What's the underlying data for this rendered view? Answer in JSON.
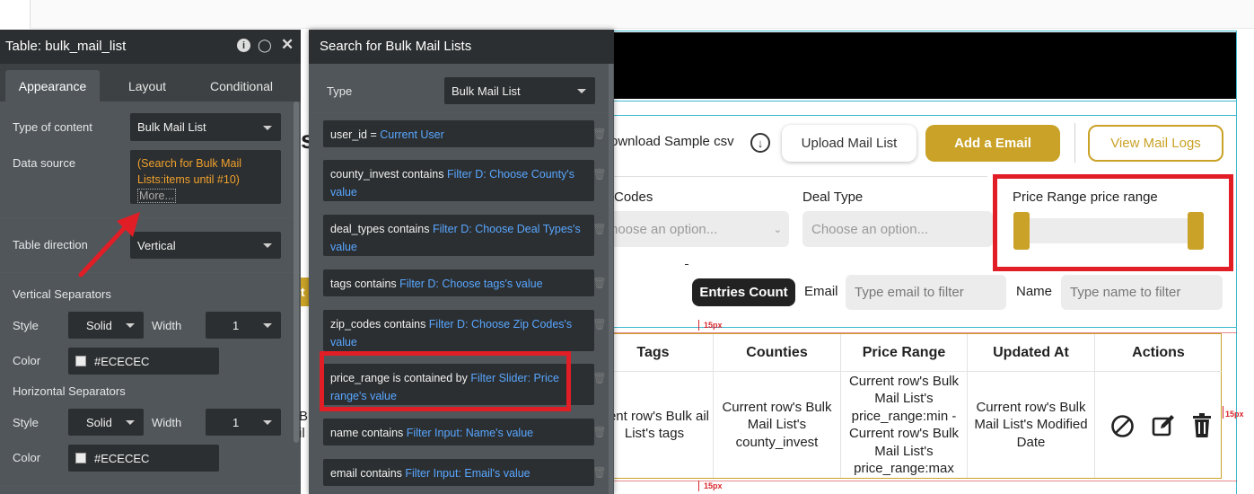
{
  "canvas": {
    "download_sample": "ownload Sample csv",
    "upload_button": "Upload Mail List",
    "add_email_button": "Add a Email",
    "view_logs_button": "View Mail Logs",
    "filters": {
      "codes_label": "Codes",
      "codes_placeholder": "hoose an option...",
      "deal_type_label": "Deal Type",
      "deal_type_placeholder": "Choose an option...",
      "price_range_label": "Price Range  price range"
    },
    "entries_count": "Entries Count",
    "email_label": "Email",
    "email_placeholder": "Type email to filter",
    "name_label": "Name",
    "name_placeholder": "Type name to filter",
    "spacing_label": "15px",
    "partial_letters": {
      "s": "s",
      "t": "t",
      "bu": "Bu",
      "il": "il"
    },
    "table": {
      "headers": [
        "Tags",
        "Counties",
        "Price Range",
        "Updated At",
        "Actions"
      ],
      "row": {
        "tags": "rrent row's Bulk ail List's tags",
        "counties": "Current row's Bulk Mail List's county_invest",
        "price_range": "Current row's Bulk Mail List's price_range:min - Current row's Bulk Mail List's price_range:max",
        "updated_at": "Current row's Bulk Mail List's Modified Date"
      },
      "action_icons": [
        "block-icon",
        "edit-icon",
        "trash-icon"
      ]
    },
    "colors": {
      "gold": "#c9a227",
      "highlight": "#e11e26"
    }
  },
  "property_panel": {
    "title": "Table: bulk_mail_list",
    "tabs": [
      "Appearance",
      "Layout",
      "Conditional"
    ],
    "active_tab": "Appearance",
    "type_of_content_label": "Type of content",
    "type_of_content_value": "Bulk Mail List",
    "data_source_label": "Data source",
    "data_source_value": "(Search for Bulk Mail Lists:items until #10)",
    "more_link": "More...",
    "table_direction_label": "Table direction",
    "table_direction_value": "Vertical",
    "vertical_separators_label": "Vertical Separators",
    "horizontal_separators_label": "Horizontal Separators",
    "style_label": "Style",
    "style_value": "Solid",
    "width_label": "Width",
    "width_value": "1",
    "color_label": "Color",
    "color_value": "#ECECEC"
  },
  "search_panel": {
    "title": "Search for Bulk Mail Lists",
    "type_label": "Type",
    "type_value": "Bulk Mail List",
    "constraints": [
      {
        "field": "user_id = ",
        "value": "Current User"
      },
      {
        "field": "county_invest contains ",
        "value": "Filter D: Choose County's value"
      },
      {
        "field": "deal_types contains ",
        "value": "Filter D: Choose Deal Types's value"
      },
      {
        "field": "tags contains ",
        "value": "Filter D: Choose tags's value"
      },
      {
        "field": "zip_codes contains ",
        "value": "Filter D: Choose Zip Codes's value"
      },
      {
        "field": "price_range  is contained by ",
        "value": "Filter Slider: Price range's value"
      },
      {
        "field": "name contains ",
        "value": "Filter Input: Name's value"
      },
      {
        "field": "email contains ",
        "value": "Filter Input: Email's value"
      }
    ]
  }
}
